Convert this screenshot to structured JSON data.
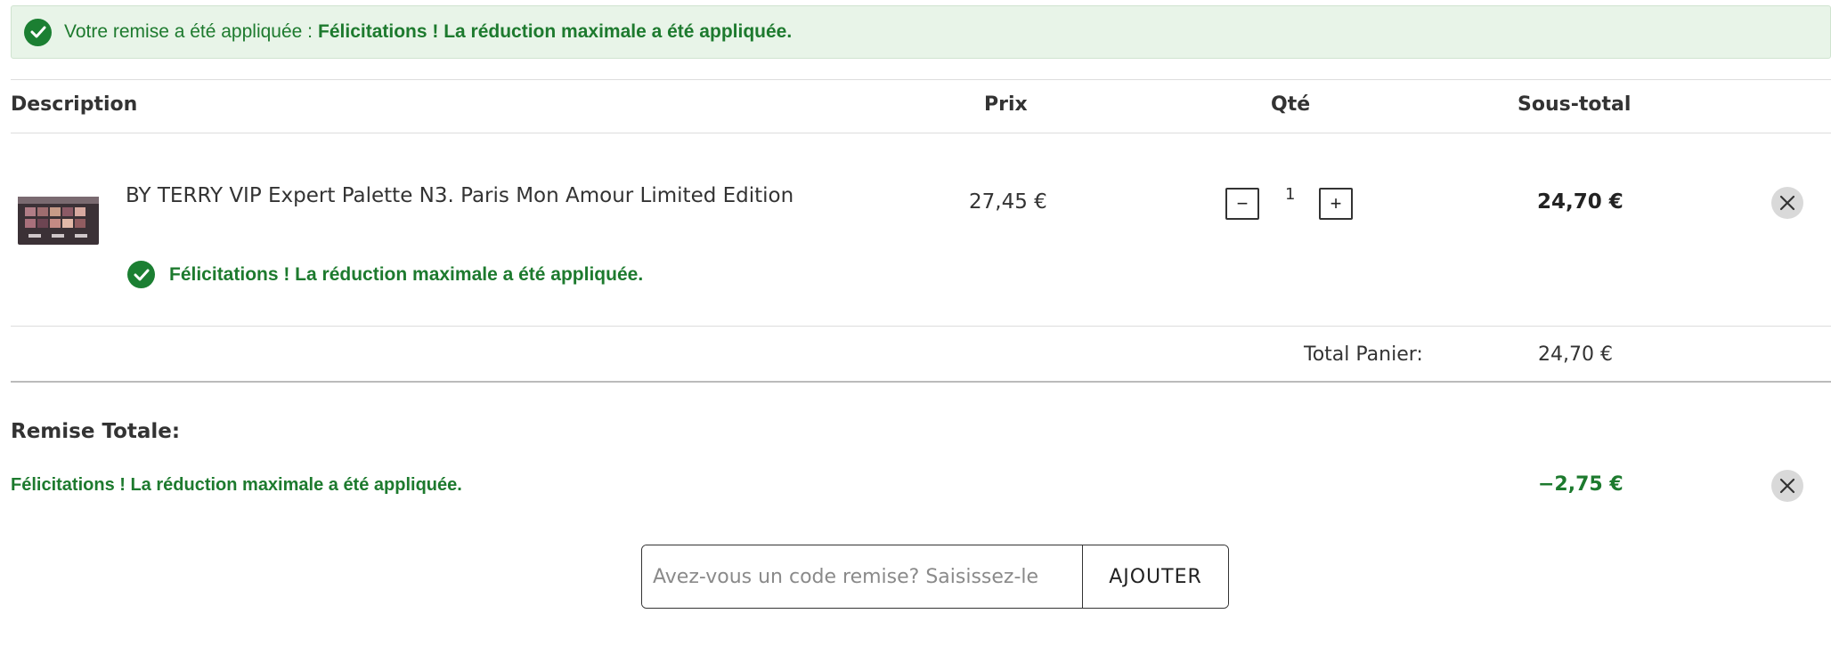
{
  "banner": {
    "prefix": "Votre remise a été appliquée :",
    "message": "Félicitations ! La réduction maximale a été appliquée.",
    "icon": "check-circle-icon"
  },
  "table": {
    "headers": {
      "description": "Description",
      "price": "Prix",
      "qty": "Qté",
      "subtotal": "Sous-total"
    }
  },
  "item": {
    "name": "BY TERRY VIP Expert Palette N3. Paris Mon Amour Limited Edition",
    "price": "27,45 €",
    "qty_minus": "−",
    "qty": "1",
    "qty_plus": "+",
    "subtotal": "24,70 €",
    "discount_message": "Félicitations ! La réduction maximale a été appliquée.",
    "remove_icon": "close-icon"
  },
  "totals": {
    "label": "Total Panier:",
    "value": "24,70 €"
  },
  "discount": {
    "title": "Remise Totale:",
    "message": "Félicitations ! La réduction maximale a été appliquée.",
    "value": "−2,75 €"
  },
  "coupon": {
    "placeholder": "Avez-vous un code remise? Saisissez-le",
    "button_label": "AJOUTER"
  },
  "colors": {
    "success_green": "#1d7a2e",
    "banner_bg": "#e8f4e8",
    "remove_bg": "#d9d9d9"
  }
}
